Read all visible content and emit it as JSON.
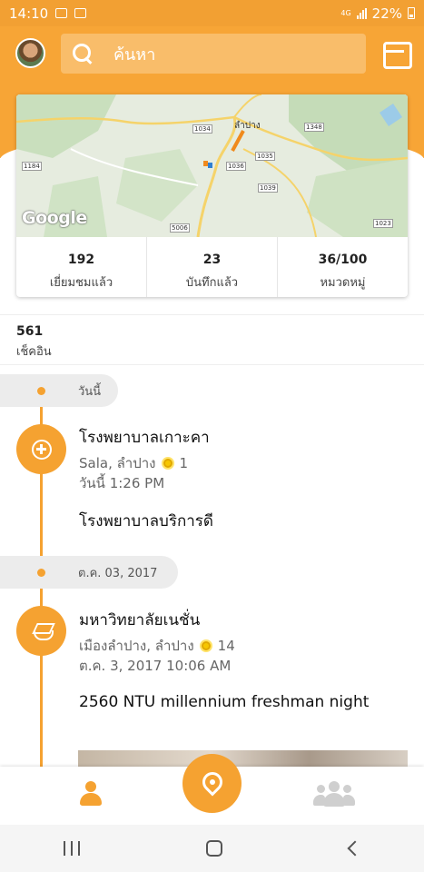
{
  "status_bar": {
    "time": "14:10",
    "network": "4G",
    "battery": "22%"
  },
  "header": {
    "search_placeholder": "ค้นหา"
  },
  "stats": [
    {
      "value": "192",
      "label": "เยี่ยมชมแล้ว"
    },
    {
      "value": "23",
      "label": "บันทึกแล้ว"
    },
    {
      "value": "36/100",
      "label": "หมวดหมู่"
    }
  ],
  "map": {
    "city_label": "ลำปาง",
    "road_labels": [
      "1034",
      "1035",
      "1036",
      "1039",
      "1348",
      "1184",
      "1184",
      "5006",
      "1023"
    ],
    "attribution": "Google"
  },
  "checkins": {
    "value": "561",
    "label": "เช็คอิน"
  },
  "timeline": {
    "groups": [
      {
        "date": "วันนี้",
        "entry": {
          "title": "โรงพยาบาลเกาะคา",
          "location": "Sala, ลำปาง",
          "coins": "1",
          "time": "วันนี้ 1:26 PM",
          "note": "โรงพยาบาลบริการดี",
          "icon": "hospital-icon"
        }
      },
      {
        "date": "ต.ค. 03, 2017",
        "entry": {
          "title": "มหาวิทยาลัยเนชั่น",
          "location": "เมืองลำปาง, ลำปาง",
          "coins": "14",
          "time": "ต.ค. 3, 2017 10:06 AM",
          "note": "2560 NTU millennium freshman night",
          "icon": "graduation-cap-icon"
        }
      }
    ]
  },
  "colors": {
    "accent": "#f5a231",
    "search_bg": "#f9bd6a",
    "coin": "#f6c600"
  }
}
